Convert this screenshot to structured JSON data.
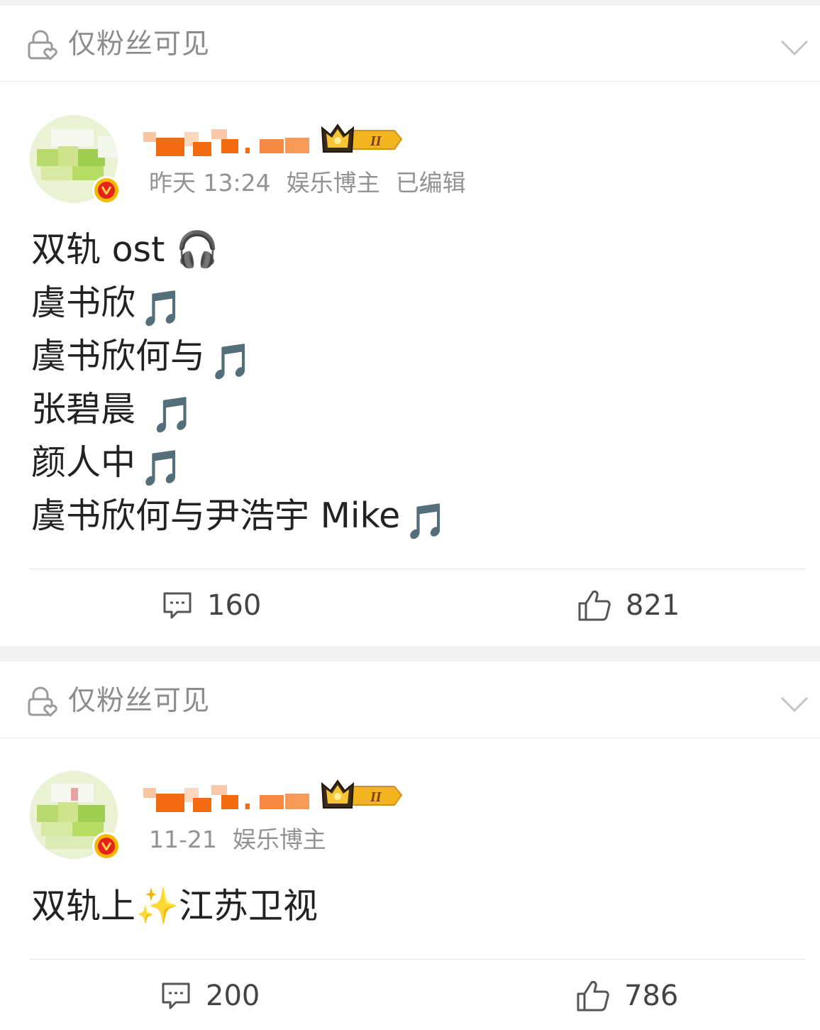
{
  "posts": [
    {
      "visibility": {
        "label": "仅粉丝可见",
        "lock_icon": "lock-heart-icon",
        "expand_icon": "chevron-down-icon"
      },
      "author": {
        "verified_badge": "verified-v-icon",
        "member_badge": "crown-level-II-badge",
        "member_level": "II"
      },
      "meta": {
        "time": "昨天 13:24",
        "role": "娱乐博主",
        "edited": "已编辑"
      },
      "content_lines": [
        "双轨 ost 🎧",
        "虞书欣",
        "虞书欣何与",
        "张碧晨 ",
        "颜人中",
        "虞书欣何与尹浩宇 Mike"
      ],
      "note_glyph": "🎵",
      "actions": {
        "comments": "160",
        "likes": "821"
      }
    },
    {
      "visibility": {
        "label": "仅粉丝可见",
        "lock_icon": "lock-heart-icon",
        "expand_icon": "chevron-down-icon"
      },
      "author": {
        "verified_badge": "verified-v-icon",
        "member_badge": "crown-level-II-badge",
        "member_level": "II"
      },
      "meta": {
        "time": "11-21",
        "role": "娱乐博主"
      },
      "content_lines": [
        "双轨上✨江苏卫视"
      ],
      "actions": {
        "comments": "200",
        "likes": "786"
      }
    }
  ],
  "colors": {
    "accent_orange": "#f26b10",
    "meta_gray": "#939393",
    "crown_gold": "#f3b51f",
    "badge_red": "#e8211c"
  }
}
